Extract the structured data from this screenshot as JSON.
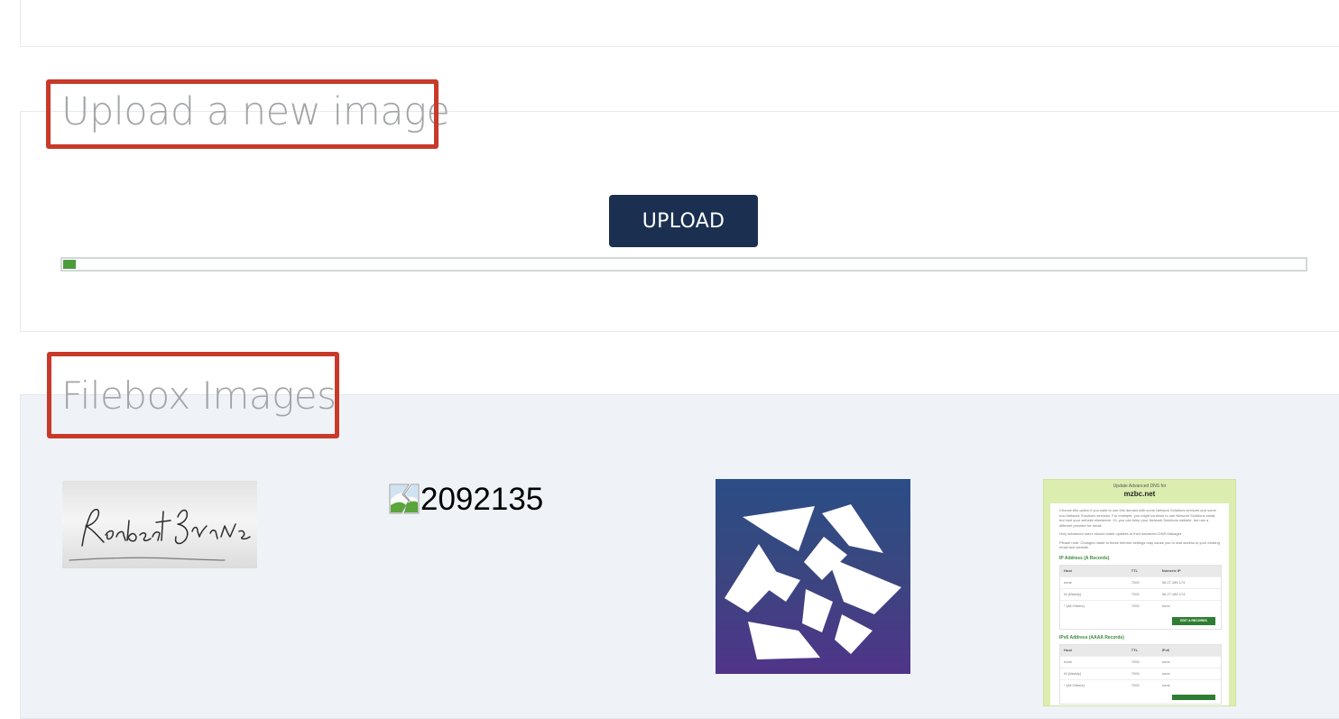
{
  "upload_section": {
    "title": "Upload a new image",
    "button_label": "UPLOAD",
    "progress_fraction": 0.01
  },
  "filebox_section": {
    "title": "Filebox Images",
    "images": [
      {
        "kind": "signature-image",
        "signature_text": "Robert Burns"
      },
      {
        "kind": "broken-image",
        "alt_text": "2092135"
      },
      {
        "kind": "logo-image"
      },
      {
        "kind": "screenshot-image",
        "screenshot": {
          "heading_small": "Update Advanced DNS for",
          "heading_domain": "mzbc.net",
          "paragraph_1": "Choose this option if you want to use this domain with some Network Solutions services and some non-Network Solutions services. For example, you might continue to use Network Solutions email, but host your website elsewhere. Or, you can keep your Network Solutions website, but use a different provider for email.",
          "paragraph_2": "Only advanced users should make updates to their Advanced DNS Manager.",
          "paragraph_3": "Please note: Changes made to these Internet settings may cause you to lose access to your existing email and website.",
          "section_a_title": "IP Address (A Records)",
          "section_a_headers": [
            "Host",
            "TTL",
            "Numeric IP"
          ],
          "section_a_rows": [
            [
              "none",
              "7200",
              "96.27.185.174"
            ],
            [
              "W (Mainly)",
              "7200",
              "96.27.185.174"
            ],
            [
              "* (All Others)",
              "7200",
              "none"
            ]
          ],
          "section_a_button": "EDIT A RECORDS",
          "section_b_title": "IPv6 Address (AAAA Records)",
          "section_b_headers": [
            "Host",
            "TTL",
            "IPv6"
          ],
          "section_b_rows": [
            [
              "none",
              "7200",
              "none"
            ],
            [
              "W (Mainly)",
              "7200",
              "none"
            ],
            [
              "* (All Others)",
              "7200",
              "none"
            ]
          ]
        }
      }
    ]
  },
  "colors": {
    "accent_button": "#1b3050",
    "progress_fill": "#4d9c3b",
    "annotation_box": "#c9392a",
    "filebox_background": "#eff3f8",
    "title_gray": "#a2a4a6"
  }
}
